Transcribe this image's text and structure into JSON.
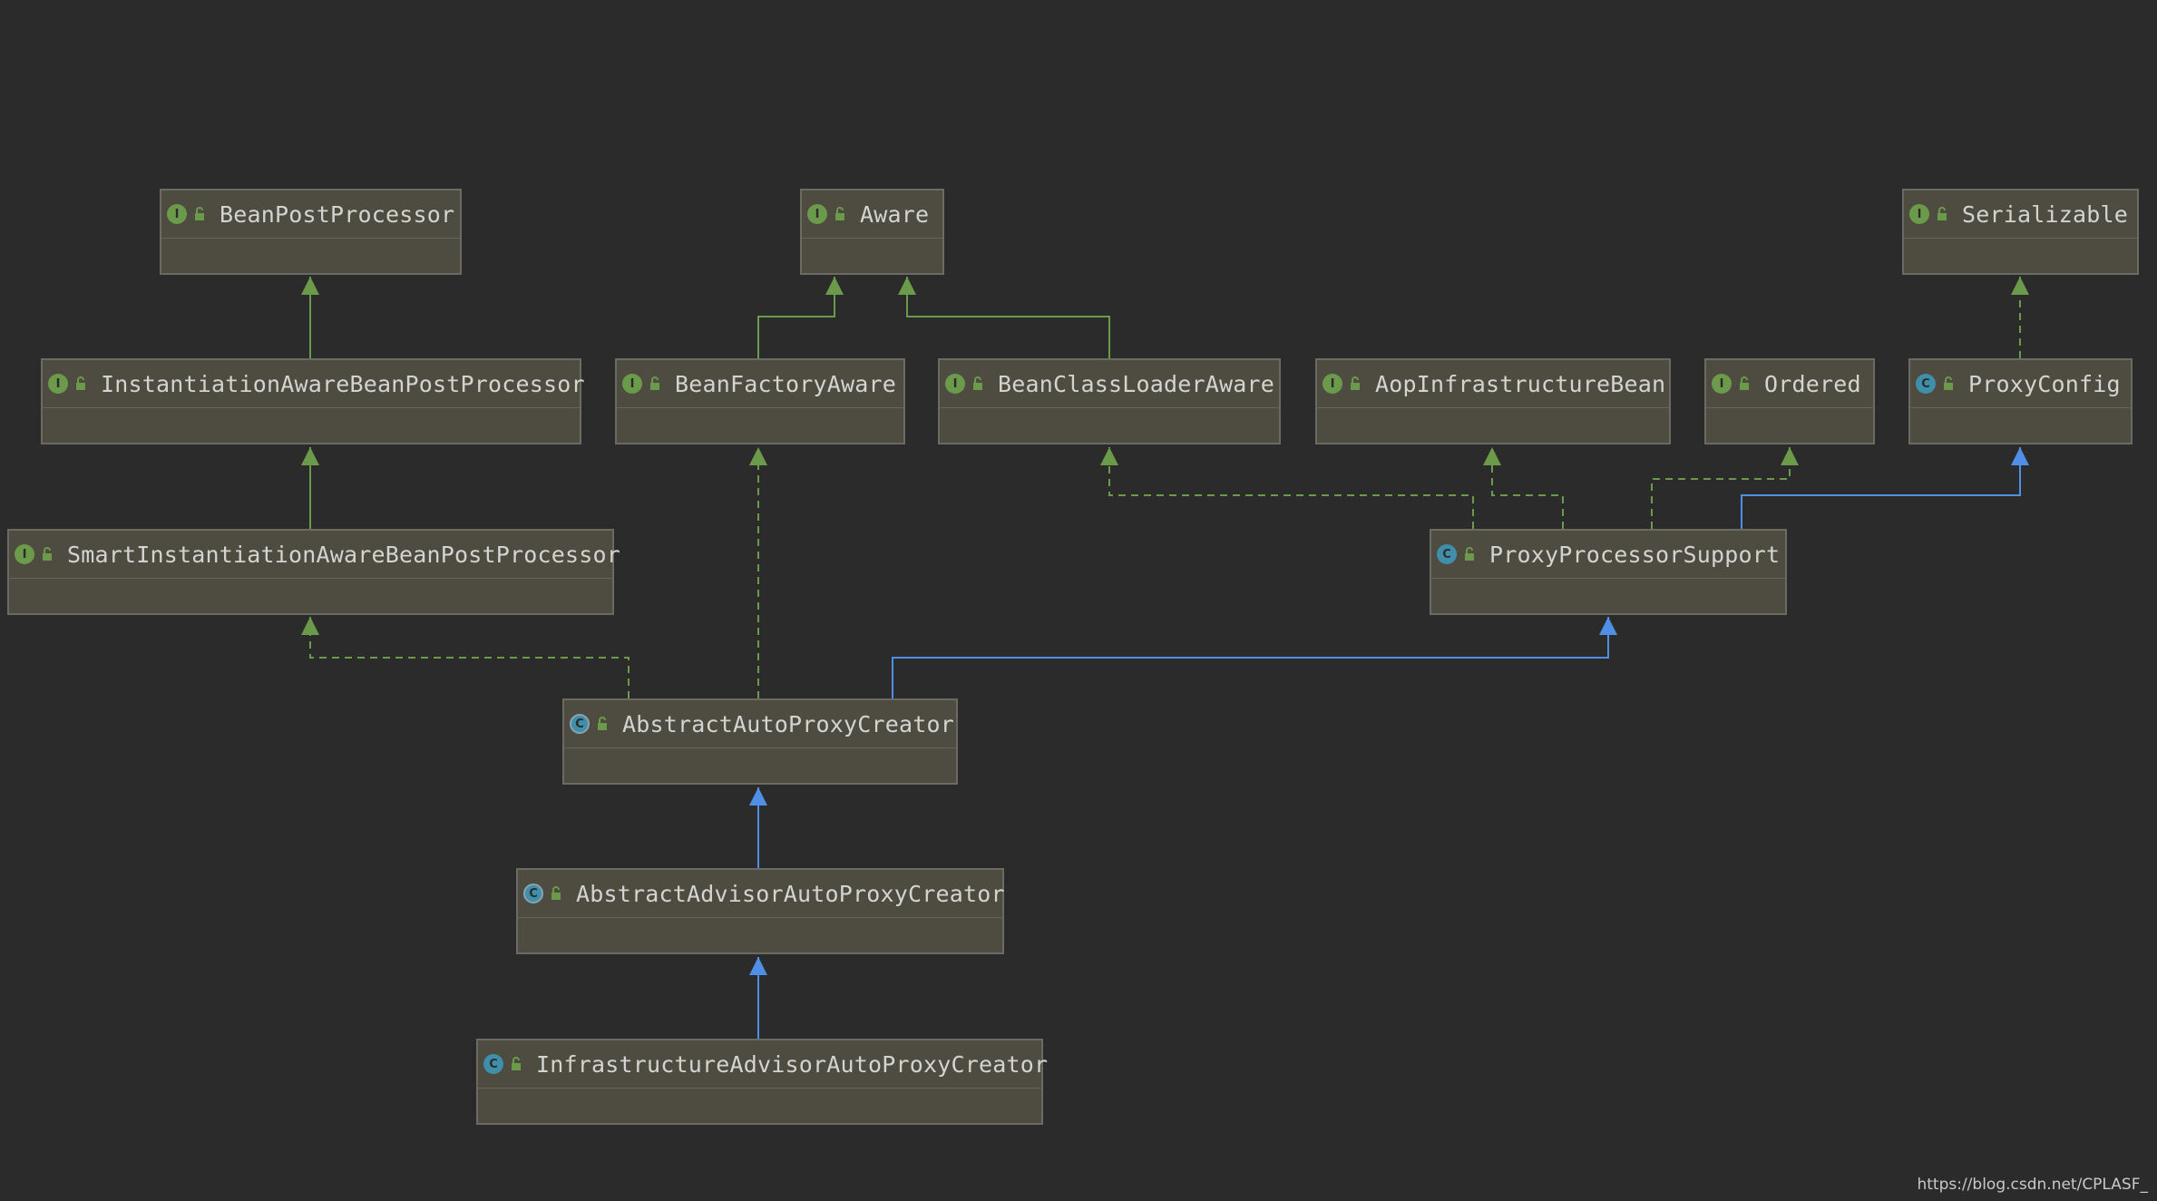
{
  "nodes": [
    {
      "id": "beanpostprocessor",
      "label": "BeanPostProcessor",
      "kind": "interface"
    },
    {
      "id": "aware",
      "label": "Aware",
      "kind": "interface"
    },
    {
      "id": "serializable",
      "label": "Serializable",
      "kind": "interface"
    },
    {
      "id": "instantiationaware",
      "label": "InstantiationAwareBeanPostProcessor",
      "kind": "interface"
    },
    {
      "id": "beanfactoryaware",
      "label": "BeanFactoryAware",
      "kind": "interface"
    },
    {
      "id": "beanclassloaderaware",
      "label": "BeanClassLoaderAware",
      "kind": "interface"
    },
    {
      "id": "aopinfrastructurebean",
      "label": "AopInfrastructureBean",
      "kind": "interface"
    },
    {
      "id": "ordered",
      "label": "Ordered",
      "kind": "interface"
    },
    {
      "id": "proxyconfig",
      "label": "ProxyConfig",
      "kind": "class"
    },
    {
      "id": "smartinstantiationaware",
      "label": "SmartInstantiationAwareBeanPostProcessor",
      "kind": "interface"
    },
    {
      "id": "proxyprocessorsupport",
      "label": "ProxyProcessorSupport",
      "kind": "class"
    },
    {
      "id": "abstractautoproxycreator",
      "label": "AbstractAutoProxyCreator",
      "kind": "abstract"
    },
    {
      "id": "abstractadvisorautoproxycreator",
      "label": "AbstractAdvisorAutoProxyCreator",
      "kind": "abstract"
    },
    {
      "id": "infrastructureadvisorautoproxycreator",
      "label": "InfrastructureAdvisorAutoProxyCreator",
      "kind": "class"
    }
  ],
  "edges": [
    {
      "from": "instantiationaware",
      "to": "beanpostprocessor",
      "type": "interface-extends"
    },
    {
      "from": "smartinstantiationaware",
      "to": "instantiationaware",
      "type": "interface-extends"
    },
    {
      "from": "beanfactoryaware",
      "to": "aware",
      "type": "interface-extends"
    },
    {
      "from": "beanclassloaderaware",
      "to": "aware",
      "type": "interface-extends"
    },
    {
      "from": "proxyconfig",
      "to": "serializable",
      "type": "implements"
    },
    {
      "from": "proxyprocessorsupport",
      "to": "beanclassloaderaware",
      "type": "implements"
    },
    {
      "from": "proxyprocessorsupport",
      "to": "aopinfrastructurebean",
      "type": "implements"
    },
    {
      "from": "proxyprocessorsupport",
      "to": "ordered",
      "type": "implements"
    },
    {
      "from": "proxyprocessorsupport",
      "to": "proxyconfig",
      "type": "extends"
    },
    {
      "from": "abstractautoproxycreator",
      "to": "smartinstantiationaware",
      "type": "implements"
    },
    {
      "from": "abstractautoproxycreator",
      "to": "beanfactoryaware",
      "type": "implements"
    },
    {
      "from": "abstractautoproxycreator",
      "to": "proxyprocessorsupport",
      "type": "extends"
    },
    {
      "from": "abstractadvisorautoproxycreator",
      "to": "abstractautoproxycreator",
      "type": "extends"
    },
    {
      "from": "infrastructureadvisorautoproxycreator",
      "to": "abstractadvisorautoproxycreator",
      "type": "extends"
    }
  ],
  "legend_colors": {
    "interface-extends": "#6c9a4b",
    "implements": "#6c9a4b",
    "extends": "#4f8fe6"
  },
  "badge_letters": {
    "interface": "I",
    "class": "C",
    "abstract": "C"
  },
  "watermark": "https://blog.csdn.net/CPLASF_"
}
